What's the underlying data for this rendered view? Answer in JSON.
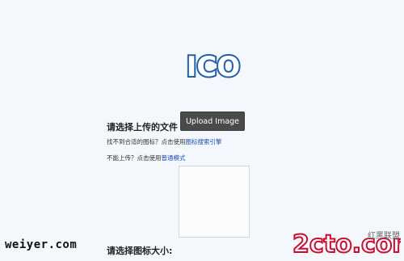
{
  "logo": {
    "text": "ICO"
  },
  "upload": {
    "section_title": "请选择上传的文件",
    "button_label": "Upload Image"
  },
  "hints": {
    "icon_not_found_prefix": "找不到合适的图标？点击使用",
    "icon_search_link": "图标搜索引擎",
    "cannot_upload_prefix": "不能上传？点击使用",
    "normal_mode_link": "普通模式"
  },
  "size": {
    "section_title": "请选择图标大小:"
  },
  "watermarks": {
    "left_text": "weiyer.com",
    "right_text": "2cto.com",
    "right_subtext": "红黑联盟"
  },
  "colors": {
    "background": "#f4f7fb",
    "logo_blue": "#1f5fa8",
    "link": "#1a4db3",
    "button_bg": "#4a4a4a",
    "watermark_red": "#c8102e"
  }
}
